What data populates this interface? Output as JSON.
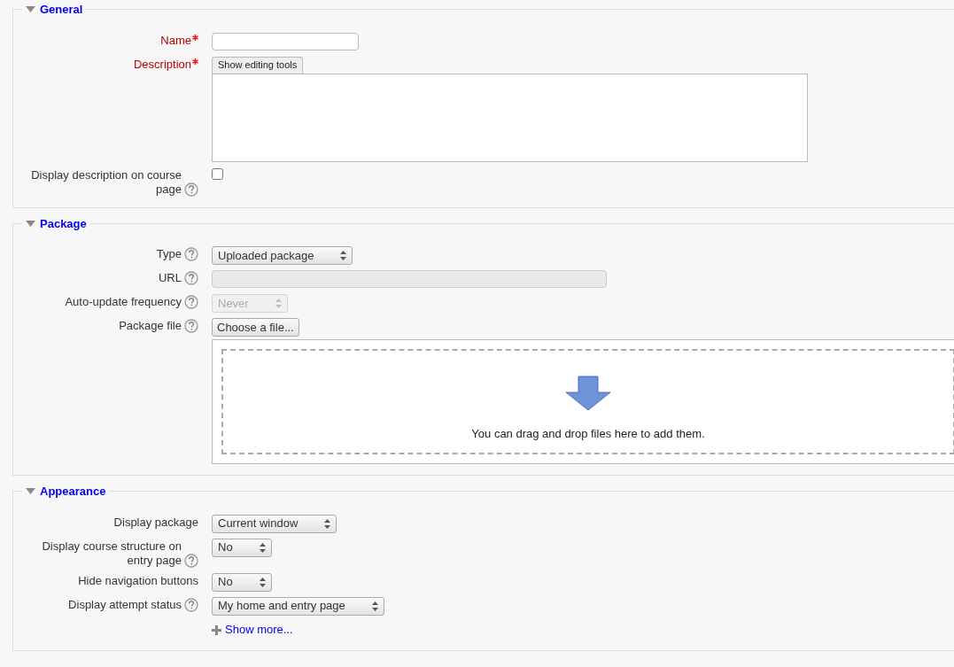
{
  "sections": [
    {
      "legend": "General",
      "expanded": true,
      "fields": [
        {
          "kind": "text",
          "label": "Name",
          "required": true,
          "help": false
        },
        {
          "kind": "editor",
          "label": "Description",
          "required": true,
          "help": false,
          "button": "Show editing tools"
        },
        {
          "kind": "checkbox",
          "label": "Display description on course page",
          "required": false,
          "help": true,
          "checked": false
        }
      ]
    },
    {
      "legend": "Package",
      "expanded": true,
      "fields": [
        {
          "kind": "select",
          "label": "Type",
          "required": false,
          "help": true,
          "value": "Uploaded package",
          "disabled": false
        },
        {
          "kind": "url",
          "label": "URL",
          "required": false,
          "help": true,
          "disabled": true
        },
        {
          "kind": "select",
          "label": "Auto-update frequency",
          "required": false,
          "help": true,
          "value": "Never",
          "disabled": true
        },
        {
          "kind": "file",
          "label": "Package file",
          "required": false,
          "help": true,
          "button": "Choose a file...",
          "drop_text": "You can drag and drop files here to add them."
        }
      ]
    },
    {
      "legend": "Appearance",
      "expanded": true,
      "fields": [
        {
          "kind": "select",
          "label": "Display package",
          "required": false,
          "help": false,
          "value": "Current window",
          "disabled": false
        },
        {
          "kind": "select",
          "label": "Display course structure on entry page",
          "required": false,
          "help": true,
          "value": "No",
          "disabled": false
        },
        {
          "kind": "select",
          "label": "Hide navigation buttons",
          "required": false,
          "help": false,
          "value": "No",
          "disabled": false
        },
        {
          "kind": "select",
          "label": "Display attempt status",
          "required": false,
          "help": true,
          "value": "My home and entry page",
          "disabled": false
        },
        {
          "kind": "link",
          "text": "Show more..."
        }
      ]
    }
  ]
}
